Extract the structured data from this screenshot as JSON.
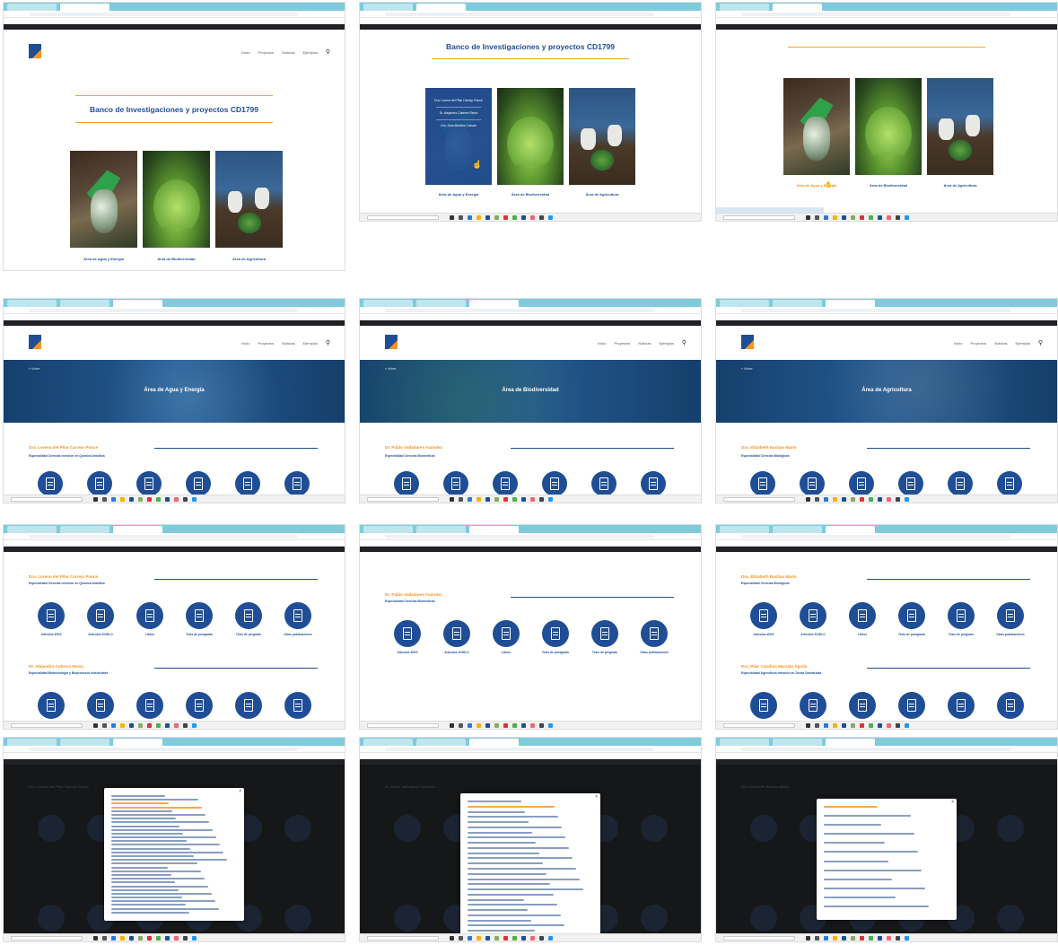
{
  "site": {
    "nav": [
      "Inicio",
      "Proyectos",
      "Noticias",
      "Ejemplos"
    ]
  },
  "landing": {
    "title": "Banco de Investigaciones y proyectos CD1799",
    "areas": [
      "Área de Agua y Energía",
      "Área de Biodiversidad",
      "Área de Agricultura"
    ],
    "hover_names": [
      "Dra. Lorena del Pilar Carrejo Ponce",
      "Dr. Alejandro Cabrera Reina",
      "Dra. Sara Miralles Cuevas"
    ]
  },
  "areas": [
    {
      "hero": "Área de Agua y Energía",
      "person": "Dra. Lorena del Pilar Carrejo Ponce",
      "spec": "Especialidad Ciencias mención en Química Analítica"
    },
    {
      "hero": "Área de Biodiversidad",
      "person": "Dr. Pablo Valladares Faúndez",
      "spec": "Especialidad Ciencias Biomédicas"
    },
    {
      "hero": "Área de Agricultura",
      "person": "Dra. Elizabeth Bastías Marín",
      "spec": "Especialidad Ciencias Biológicas"
    }
  ],
  "profiles": [
    {
      "person": "Dra. Lorena del Pilar Carrejo Ponce",
      "spec": "Especialidad Ciencias mención en Química Analítica",
      "person2": "Dr. Alejandro Cabrera Reina",
      "spec2": "Especialidad Biotecnología y Bioprocesos Industriales"
    },
    {
      "person": "Dr. Pablo Valladares Faúndez",
      "spec": "Especialidad Ciencias Biomédicas"
    },
    {
      "person": "Dra. Elizabeth Bastías Marín",
      "spec": "Especialidad Ciencias Biológicas",
      "person2": "Dra. Pilar Carolina Marzala Águila",
      "spec2": "Especialidad Agricultura mención en Zonas Semiáridas"
    }
  ],
  "publication_types": [
    "Artículos WOS",
    "Artículos SCIELO",
    "Libros",
    "Tesis de postgrado",
    "Tesis de pregrado",
    "Otras publicaciones"
  ],
  "colors": {
    "brand_blue": "#1f4e96",
    "accent_orange": "#f7931e",
    "chrome_tab": "#7fcbdc"
  }
}
